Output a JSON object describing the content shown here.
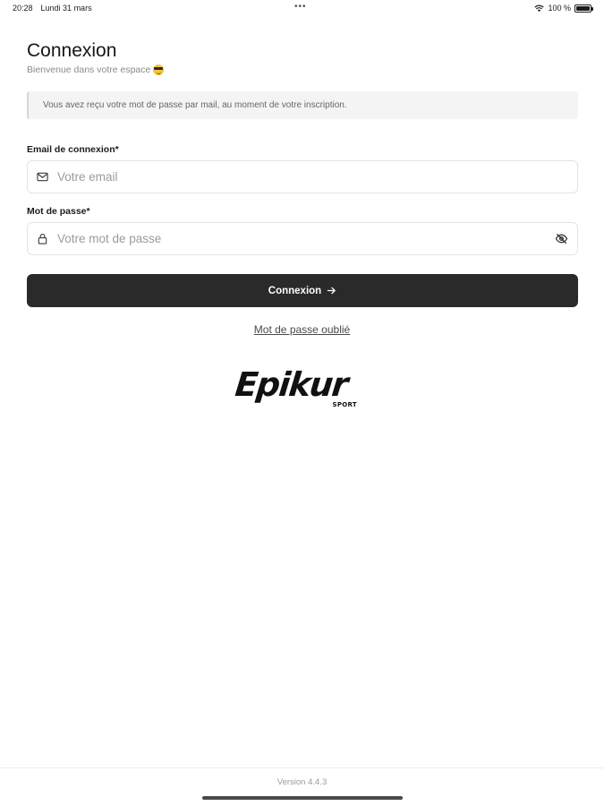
{
  "status_bar": {
    "time": "20:28",
    "date": "Lundi 31 mars",
    "dots": "•••",
    "battery": "100 %"
  },
  "header": {
    "title": "Connexion",
    "subtitle": "Bienvenue dans votre espace"
  },
  "info": {
    "message": "Vous avez reçu votre mot de passe par mail, au moment de votre inscription."
  },
  "form": {
    "email_label": "Email de connexion*",
    "email_placeholder": "Votre email",
    "email_icon": "mail-icon",
    "password_label": "Mot de passe*",
    "password_placeholder": "Votre mot de passe",
    "password_icon": "lock-icon",
    "visibility_icon": "eye-off-icon",
    "submit_label": "Connexion",
    "forgot_label": "Mot de passe oublié"
  },
  "brand": {
    "logo_text": "Epikur",
    "logo_subtext": "SPORT"
  },
  "footer": {
    "version": "Version 4.4.3"
  },
  "colors": {
    "button_bg": "#2a2a2a",
    "info_bg": "#f4f4f4",
    "placeholder": "#9b9b9b"
  }
}
